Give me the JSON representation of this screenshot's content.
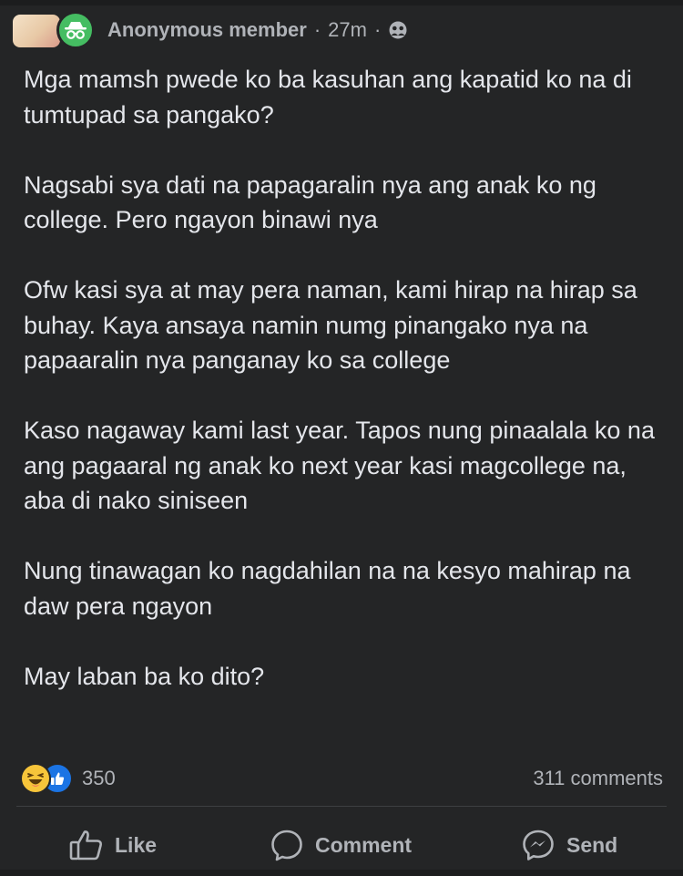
{
  "header": {
    "author": "Anonymous member",
    "separator": "·",
    "time": "27m",
    "separator2": "·",
    "privacy_icon": "group-privacy-icon",
    "avatar_icon": "incognito-icon"
  },
  "post": {
    "paragraphs": [
      "Mga mamsh pwede ko ba kasuhan ang kapatid ko na di tumtupad sa pangako?",
      "Nagsabi sya dati na papagaralin nya ang anak ko ng college. Pero ngayon binawi nya",
      "Ofw kasi sya at may pera naman, kami hirap na hirap sa buhay. Kaya ansaya namin numg pinangako nya na papaaralin nya panganay ko sa college",
      "Kaso nagaway kami last year. Tapos nung pinaalala ko na ang pagaaral ng anak ko next year kasi magcollege na, aba di nako siniseen",
      "Nung tinawagan ko nagdahilan na na kesyo mahirap na daw pera ngayon",
      "May laban ba ko dito?"
    ]
  },
  "stats": {
    "reaction_count": "350",
    "comments": "311 comments",
    "reaction_icons": [
      "haha-icon",
      "like-reaction-icon"
    ]
  },
  "actions": {
    "like": "Like",
    "comment": "Comment",
    "send": "Send"
  },
  "colors": {
    "background": "#242526",
    "text": "#e4e6eb",
    "secondary_text": "#b0b3b8",
    "anon_green": "#45bd62",
    "like_blue": "#1b74e4",
    "haha_yellow": "#f7c53a"
  }
}
